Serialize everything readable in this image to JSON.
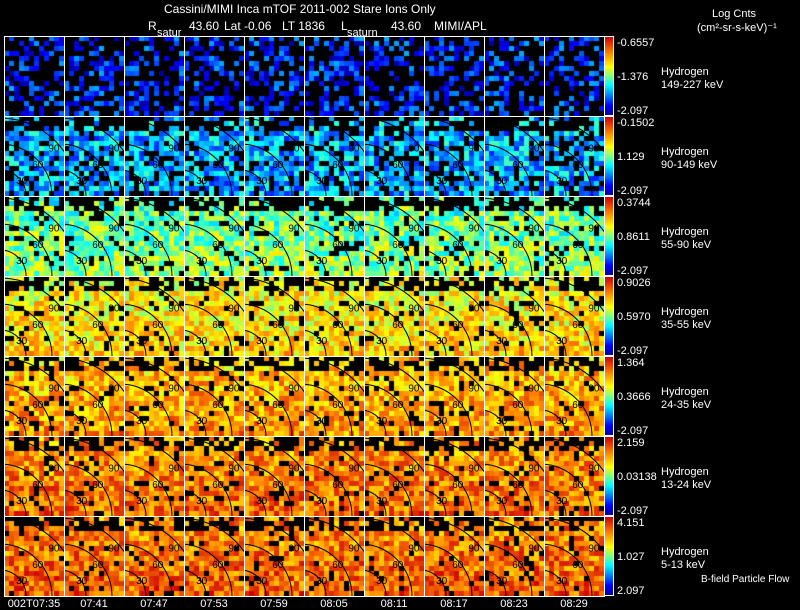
{
  "chart_data": {
    "type": "heatmap",
    "title": "Cassini/MIMI Inca mTOF  2011-002   Stare   Ions Only",
    "subtitle": {
      "r_label": "R",
      "r_value": "43.60",
      "lat": "Lat -0.06",
      "lt": "LT 1836",
      "l_label": "L",
      "l_value": "43.60",
      "credit": "MIMI/APL"
    },
    "panel_labels": [
      "satur",
      "saturn"
    ],
    "colorbar_title": [
      "Log Cnts",
      "(cm²-sr-s-keV)⁻¹"
    ],
    "times": [
      "002T07:35",
      "07:41",
      "07:47",
      "07:53",
      "07:59",
      "08:05",
      "08:11",
      "08:17",
      "08:23",
      "08:29"
    ],
    "contour_labels": [
      "30",
      "60",
      "90"
    ],
    "rows": [
      {
        "species": "Hydrogen",
        "energy": "149-227 keV",
        "cmax": "-0.6557",
        "cmid": "-1.376",
        "cmin": "-2.097",
        "level": 0.15,
        "density": 0.45
      },
      {
        "species": "Hydrogen",
        "energy": "90-149 keV",
        "cmax": "-0.1502",
        "cmid": "1.129",
        "cmin": "-2.097",
        "level": 0.3,
        "density": 0.75
      },
      {
        "species": "Hydrogen",
        "energy": "55-90 keV",
        "cmax": "0.3744",
        "cmid": "0.8611",
        "cmin": "-2.097",
        "level": 0.45,
        "density": 0.85
      },
      {
        "species": "Hydrogen",
        "energy": "35-55 keV",
        "cmax": "0.9026",
        "cmid": "0.5970",
        "cmin": "-2.097",
        "level": 0.62,
        "density": 0.88
      },
      {
        "species": "Hydrogen",
        "energy": "24-35 keV",
        "cmax": "1.364",
        "cmid": "0.3666",
        "cmin": "-2.097",
        "level": 0.7,
        "density": 0.9
      },
      {
        "species": "Hydrogen",
        "energy": "13-24 keV",
        "cmax": "2.159",
        "cmid": "0.03138",
        "cmin": "-2.097",
        "level": 0.76,
        "density": 0.9
      },
      {
        "species": "Hydrogen",
        "energy": "5-13 keV",
        "cmax": "4.151",
        "cmid": "1.027",
        "cmin": "2.097",
        "level": 0.78,
        "density": 0.92
      }
    ],
    "footer_note": "B-field Particle Flow"
  }
}
